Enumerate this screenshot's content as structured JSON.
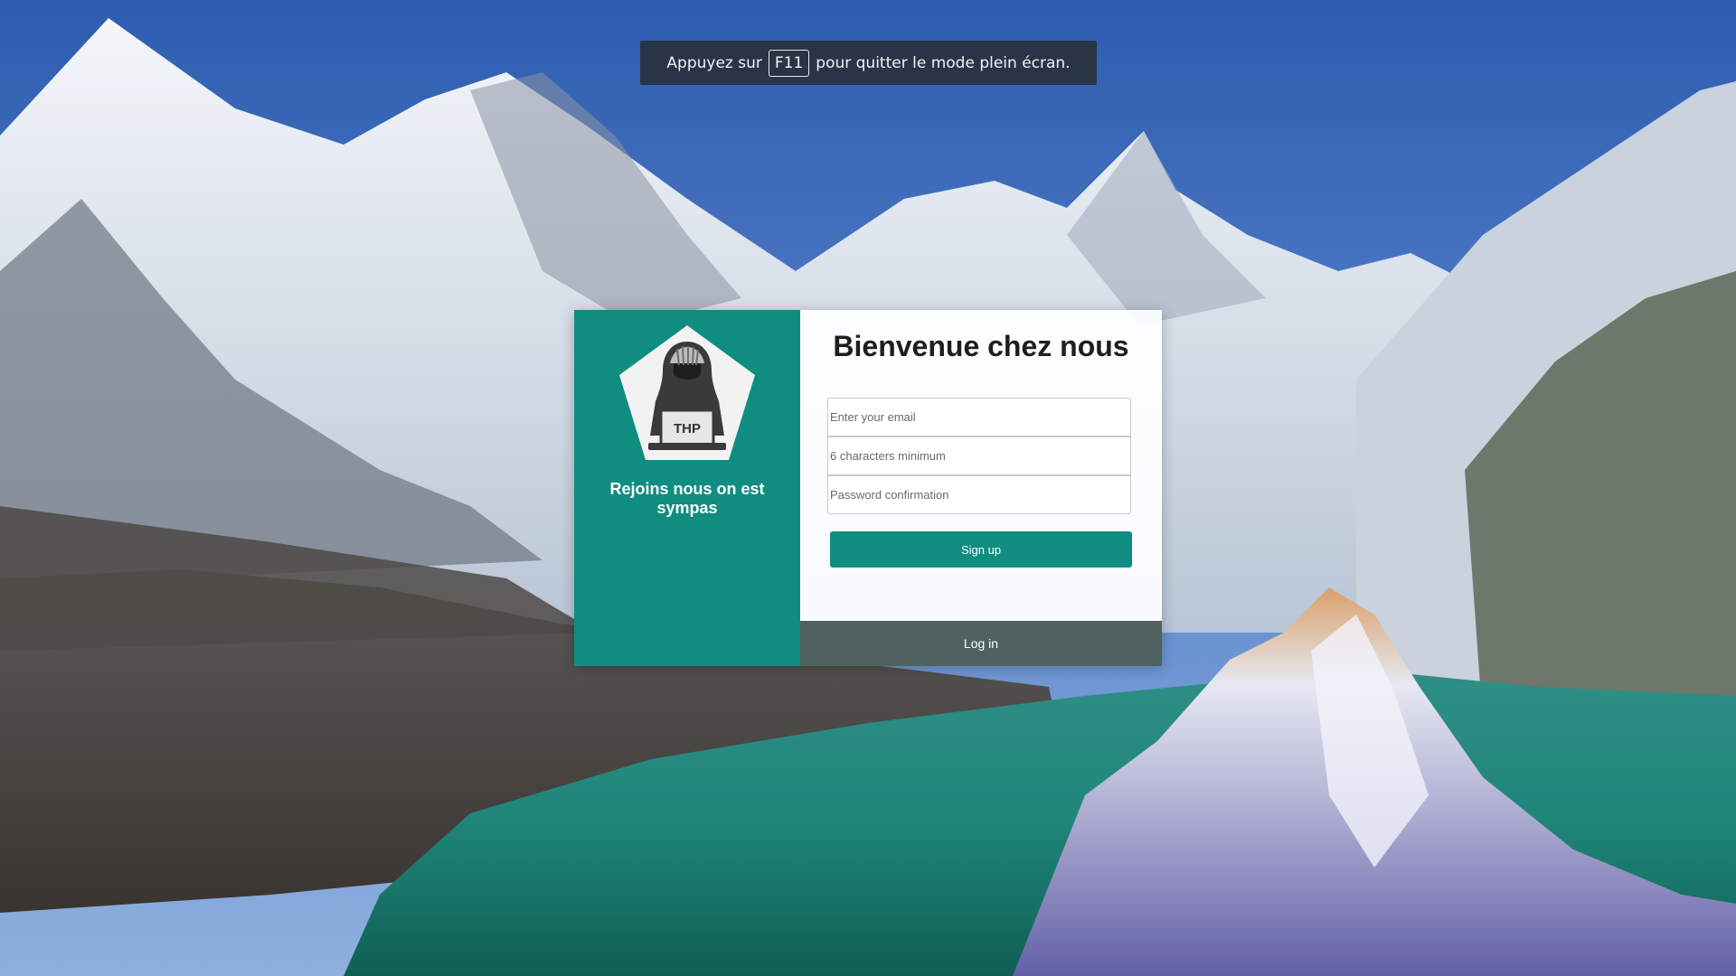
{
  "fullscreen_notice": {
    "prefix": "Appuyez sur",
    "key": "F11",
    "suffix": "pour quitter le mode plein écran."
  },
  "left_panel": {
    "logo_text": "THP",
    "tagline": "Rejoins nous on est sympas"
  },
  "form": {
    "title": "Bienvenue chez nous",
    "email_placeholder": "Enter your email",
    "password_placeholder": "6 characters minimum",
    "password_confirmation_placeholder": "Password confirmation",
    "signup_label": "Sign up",
    "login_label": "Log in"
  },
  "colors": {
    "accent": "#0f8d80",
    "login_bar": "#50625e"
  },
  "icons": {
    "logo": "hacker-hood-icon"
  }
}
